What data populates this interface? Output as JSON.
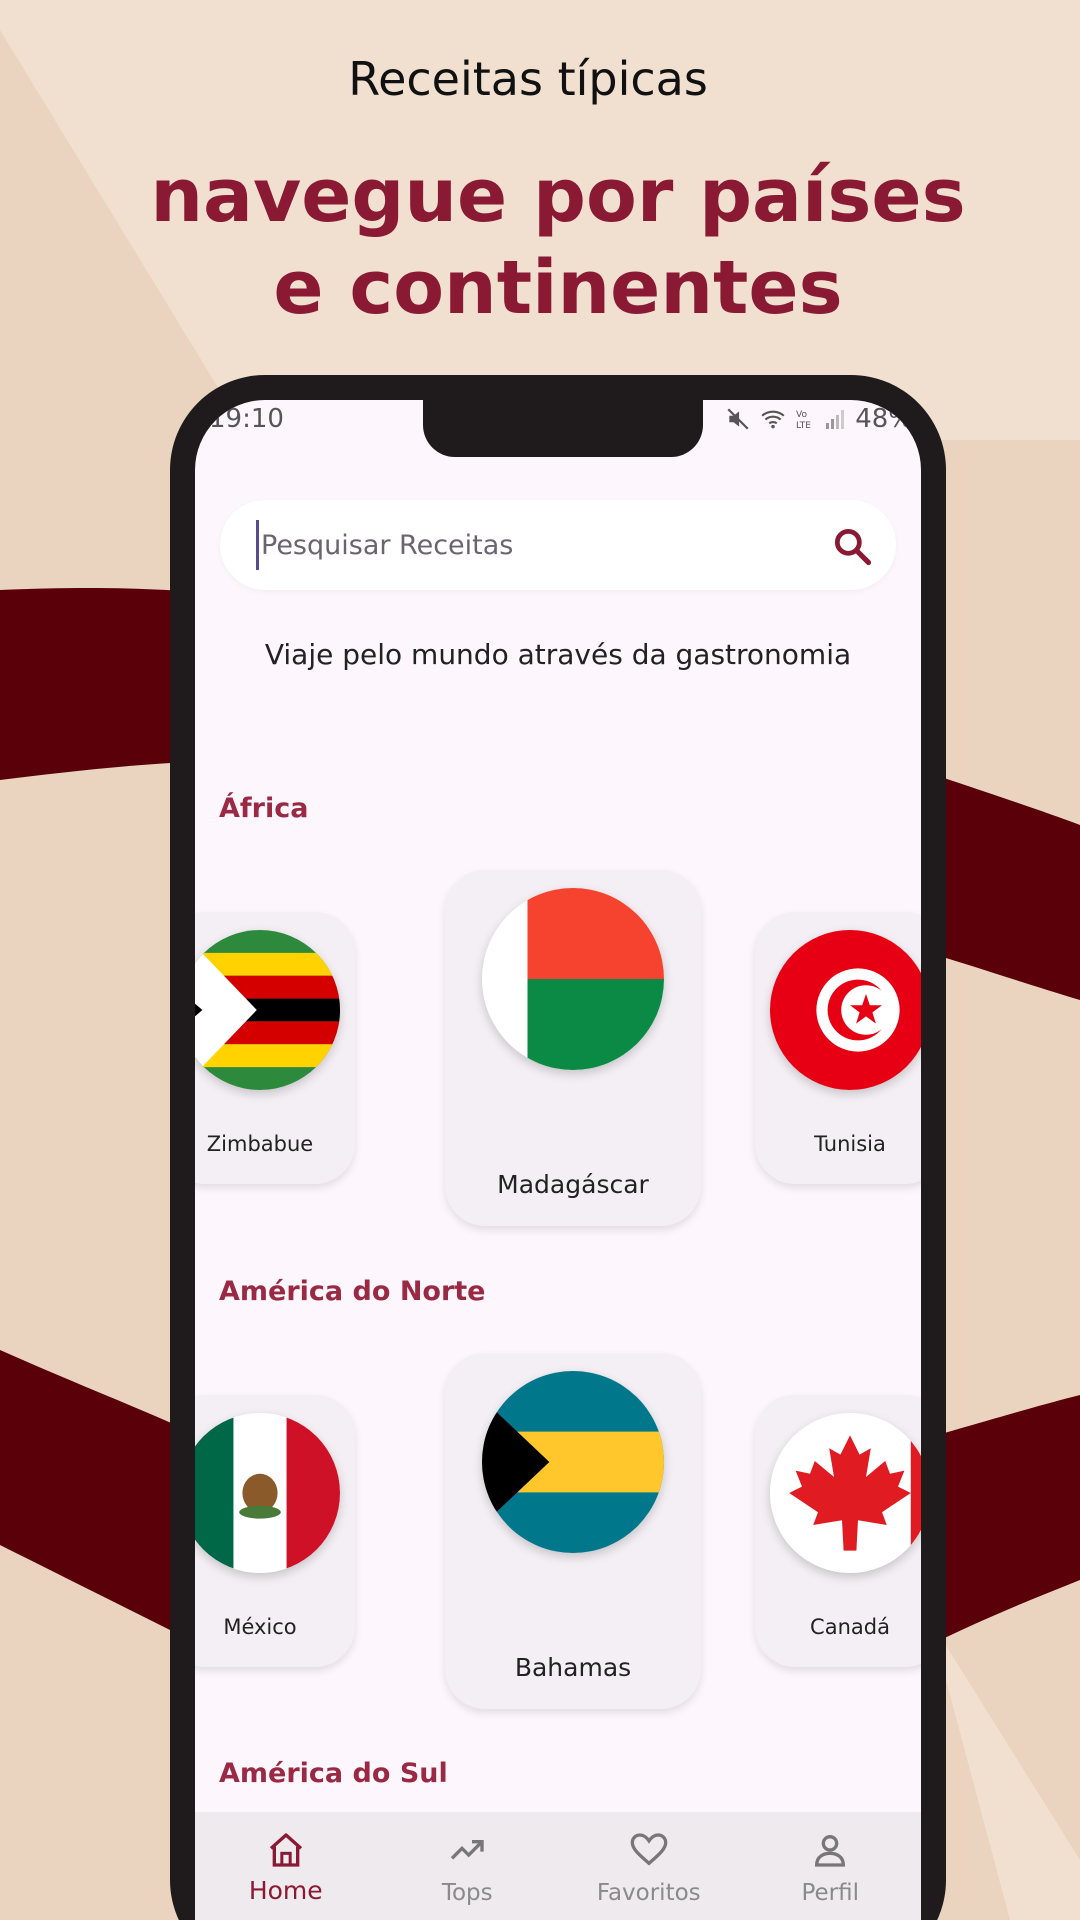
{
  "promo": {
    "subtitle": "Receitas típicas",
    "title_line1": "navegue por países",
    "title_line2": "e continentes"
  },
  "status_bar": {
    "time": "19:10",
    "battery": "48%"
  },
  "search": {
    "placeholder": "Pesquisar Receitas",
    "value": ""
  },
  "tagline": "Viaje pelo mundo através da gastronomia",
  "sections": [
    {
      "title": "África",
      "countries": [
        "Zimbabue",
        "Madagáscar",
        "Tunisia"
      ]
    },
    {
      "title": "América do Norte",
      "countries": [
        "México",
        "Bahamas",
        "Canadá"
      ]
    },
    {
      "title": "América do Sul"
    }
  ],
  "bottom_nav": {
    "items": [
      "Home",
      "Tops",
      "Favoritos",
      "Perfil"
    ],
    "active": "Home"
  },
  "colors": {
    "accent": "#8a1a34",
    "background": "#ead3bf",
    "wave": "#5a0008",
    "screen": "#fdf6fc"
  }
}
